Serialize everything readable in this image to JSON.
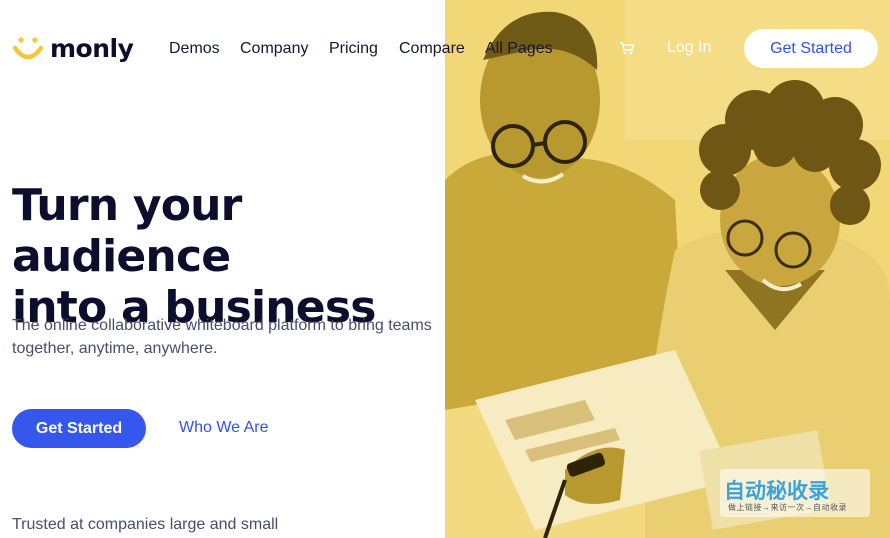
{
  "brand": {
    "name": "monly",
    "accent": "#3557ee",
    "photo_tint": "#f1d776"
  },
  "nav": {
    "links": [
      "Demos",
      "Company",
      "Pricing",
      "Compare",
      "All Pages"
    ],
    "cart_icon": "cart-icon",
    "login_label": "Log In",
    "cta_label": "Get Started"
  },
  "hero": {
    "headline_line1": "Turn your audience",
    "headline_line2": "into a business",
    "subheadline_line1": "The online collaborative whiteboard platform to bring teams",
    "subheadline_line2": "together, anytime, anywhere.",
    "primary_cta": "Get Started",
    "secondary_cta": "Who We Are",
    "trusted_text": "Trusted at companies large and small"
  },
  "watermark": {
    "main": "自动秘收录",
    "sub": "做上链接→来访一次→自动收录"
  }
}
